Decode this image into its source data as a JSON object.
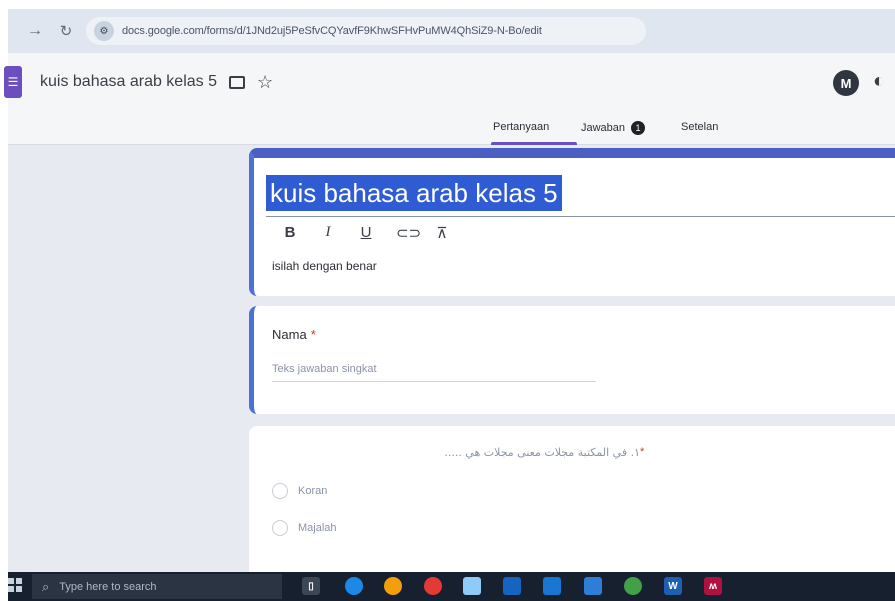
{
  "browser": {
    "url": "docs.google.com/forms/d/1JNd2uj5PeSfvCQYavfF9KhwSFHvPuMW4QhSiZ9-N-Bo/edit",
    "back_icon": "arrow-right-icon",
    "reload_icon": "reload-icon"
  },
  "header": {
    "title": "kuis bahasa arab kelas 5",
    "addon_initial": "M"
  },
  "tabs": {
    "questions": "Pertanyaan",
    "responses": "Jawaban",
    "responses_count": "1",
    "settings": "Setelan"
  },
  "form": {
    "title": "kuis bahasa arab kelas 5",
    "format": {
      "bold": "B",
      "italic": "I",
      "underline": "U"
    },
    "description": "isilah dengan benar"
  },
  "question_nama": {
    "label": "Nama",
    "required_mark": "*",
    "placeholder": "Teks jawaban singkat"
  },
  "question_1": {
    "text": "١. في المكتبة مجلات معنى مجلات هي .....",
    "required_mark": "*",
    "options": [
      "Koran",
      "Majalah"
    ]
  },
  "taskbar": {
    "search_placeholder": "Type here to search"
  },
  "colors": {
    "accent": "#6b4fbf",
    "title_highlight": "#2f5bd3",
    "card_border": "#4a72d6",
    "taskbar": "#16202e"
  }
}
